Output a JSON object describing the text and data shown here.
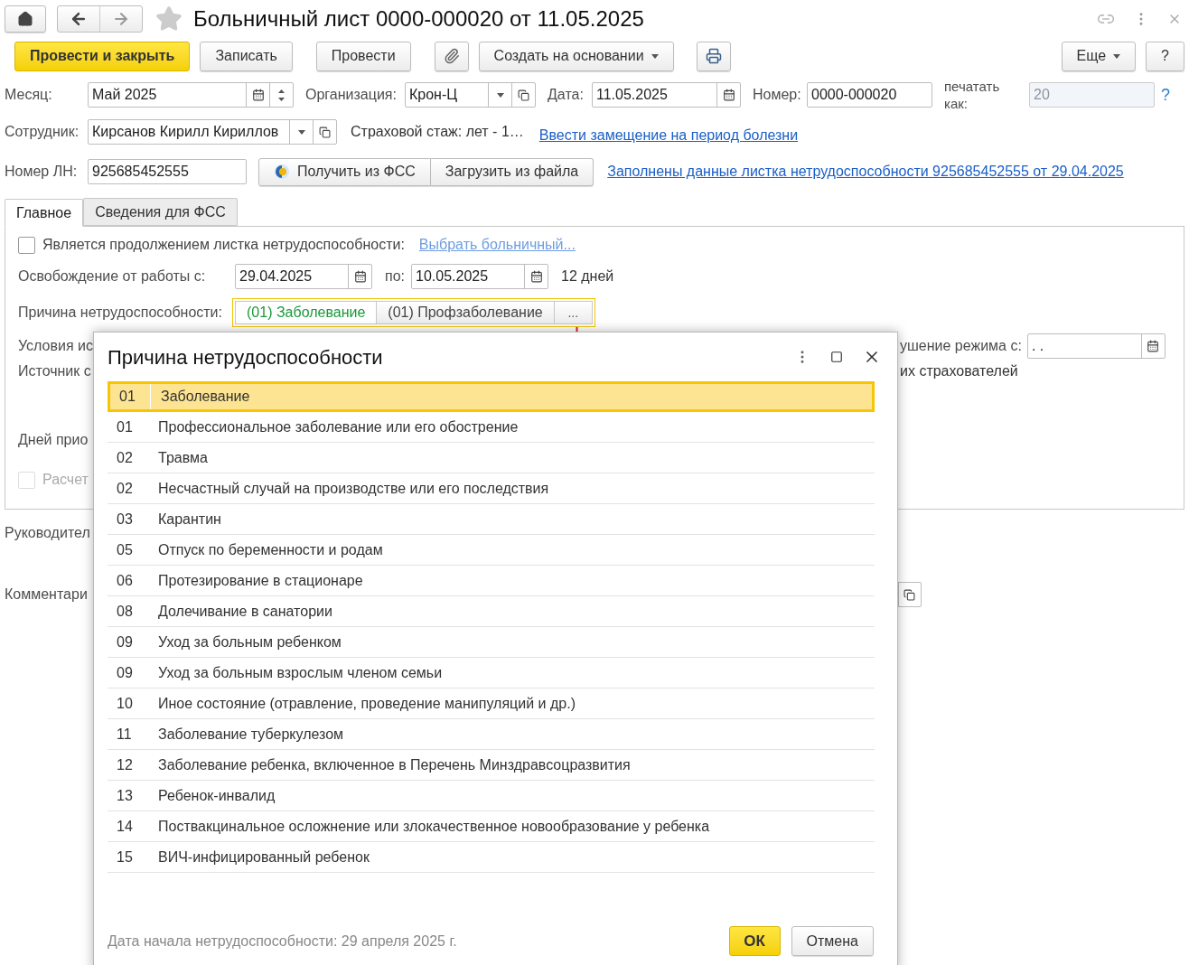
{
  "window": {
    "title": "Больничный лист 0000-000020 от 11.05.2025",
    "favorite": false
  },
  "toolbar": {
    "left": [
      {
        "kind": "primary",
        "label": "Провести и закрыть"
      },
      {
        "kind": "button",
        "label": "Записать"
      },
      {
        "kind": "button",
        "label": "Провести"
      },
      {
        "kind": "attach"
      },
      {
        "kind": "menu",
        "label": "Создать на основании"
      },
      {
        "kind": "print"
      }
    ],
    "right": [
      {
        "kind": "menu",
        "label": "Еще"
      },
      {
        "kind": "button",
        "label": "?"
      }
    ]
  },
  "month": {
    "label": "Месяц:",
    "value": "Май 2025"
  },
  "organization": {
    "label": "Организация:",
    "value": "Крон-Ц"
  },
  "date": {
    "label": "Дата:",
    "value": "11.05.2025"
  },
  "number": {
    "label": "Номер:",
    "value": "0000-000020"
  },
  "print_as": {
    "label": "печатать как:",
    "value": "20",
    "disabled": true,
    "help": "?"
  },
  "employee": {
    "label": "Сотрудник:",
    "value": "Кирсанов Кирилл Кириллов"
  },
  "insurance_period": "Страховой стаж: лет - 1…",
  "replacement_link": "Ввести замещение на период болезни",
  "ln_number": {
    "label": "Номер ЛН:",
    "value": "925685452555"
  },
  "fss_buttons": [
    "Получить из ФСС",
    "Загрузить из файла"
  ],
  "filled_link": "Заполнены данные листка нетрудоспособности 925685452555 от 29.04.2025",
  "tabs": [
    {
      "label": "Главное",
      "selected": true
    },
    {
      "label": "Сведения для ФСС",
      "selected": false
    }
  ],
  "main": {
    "continuation": {
      "label": "Является продолжением листка нетрудоспособности:",
      "checked": false,
      "link": "Выбрать больничный..."
    },
    "release": {
      "label": "Освобождение от работы с:",
      "from": "29.04.2025",
      "to_label": "по:",
      "to": "10.05.2025",
      "days": "12 дней"
    },
    "reason": {
      "label": "Причина нетрудоспособности:",
      "options": [
        {
          "label": "(01) Заболевание",
          "selected": true
        },
        {
          "label": "(01) Профзаболевание",
          "selected": false
        }
      ],
      "more": "..."
    },
    "conditions_label": "Условия ис",
    "violation": {
      "label": "ушение режима с:",
      "value": " .  ."
    },
    "source_label": "Источник с",
    "insurers_text": "их страхователей",
    "days_label": "Дней прио",
    "calculation": {
      "label": "Расчет",
      "checked": false,
      "disabled": true
    }
  },
  "manager_label": "Руководител",
  "comment_label": "Комментари",
  "dialog": {
    "title": "Причина нетрудоспособности",
    "rows": [
      {
        "code": "01",
        "name": "Заболевание",
        "selected": true
      },
      {
        "code": "01",
        "name": "Профессиональное заболевание или его обострение",
        "selected": false
      },
      {
        "code": "02",
        "name": "Травма",
        "selected": false
      },
      {
        "code": "02",
        "name": "Несчастный случай на производстве или его последствия",
        "selected": false
      },
      {
        "code": "03",
        "name": "Карантин",
        "selected": false
      },
      {
        "code": "05",
        "name": "Отпуск по беременности и родам",
        "selected": false
      },
      {
        "code": "06",
        "name": "Протезирование в стационаре",
        "selected": false
      },
      {
        "code": "08",
        "name": "Долечивание в санатории",
        "selected": false
      },
      {
        "code": "09",
        "name": "Уход за больным ребенком",
        "selected": false
      },
      {
        "code": "09",
        "name": "Уход за больным взрослым членом семьи",
        "selected": false
      },
      {
        "code": "10",
        "name": "Иное состояние (отравление, проведение манипуляций и др.)",
        "selected": false
      },
      {
        "code": "11",
        "name": "Заболевание туберкулезом",
        "selected": false
      },
      {
        "code": "12",
        "name": "Заболевание ребенка, включенное в Перечень Минздравсоцразвития",
        "selected": false
      },
      {
        "code": "13",
        "name": "Ребенок-инвалид",
        "selected": false
      },
      {
        "code": "14",
        "name": "Поствакцинальное осложнение или злокачественное новообразование у ребенка",
        "selected": false
      },
      {
        "code": "15",
        "name": "ВИЧ-инфицированный ребенок",
        "selected": false
      }
    ],
    "footer_text": "Дата начала нетрудоспособности: 29 апреля 2025 г.",
    "ok": "ОК",
    "cancel": "Отмена"
  }
}
